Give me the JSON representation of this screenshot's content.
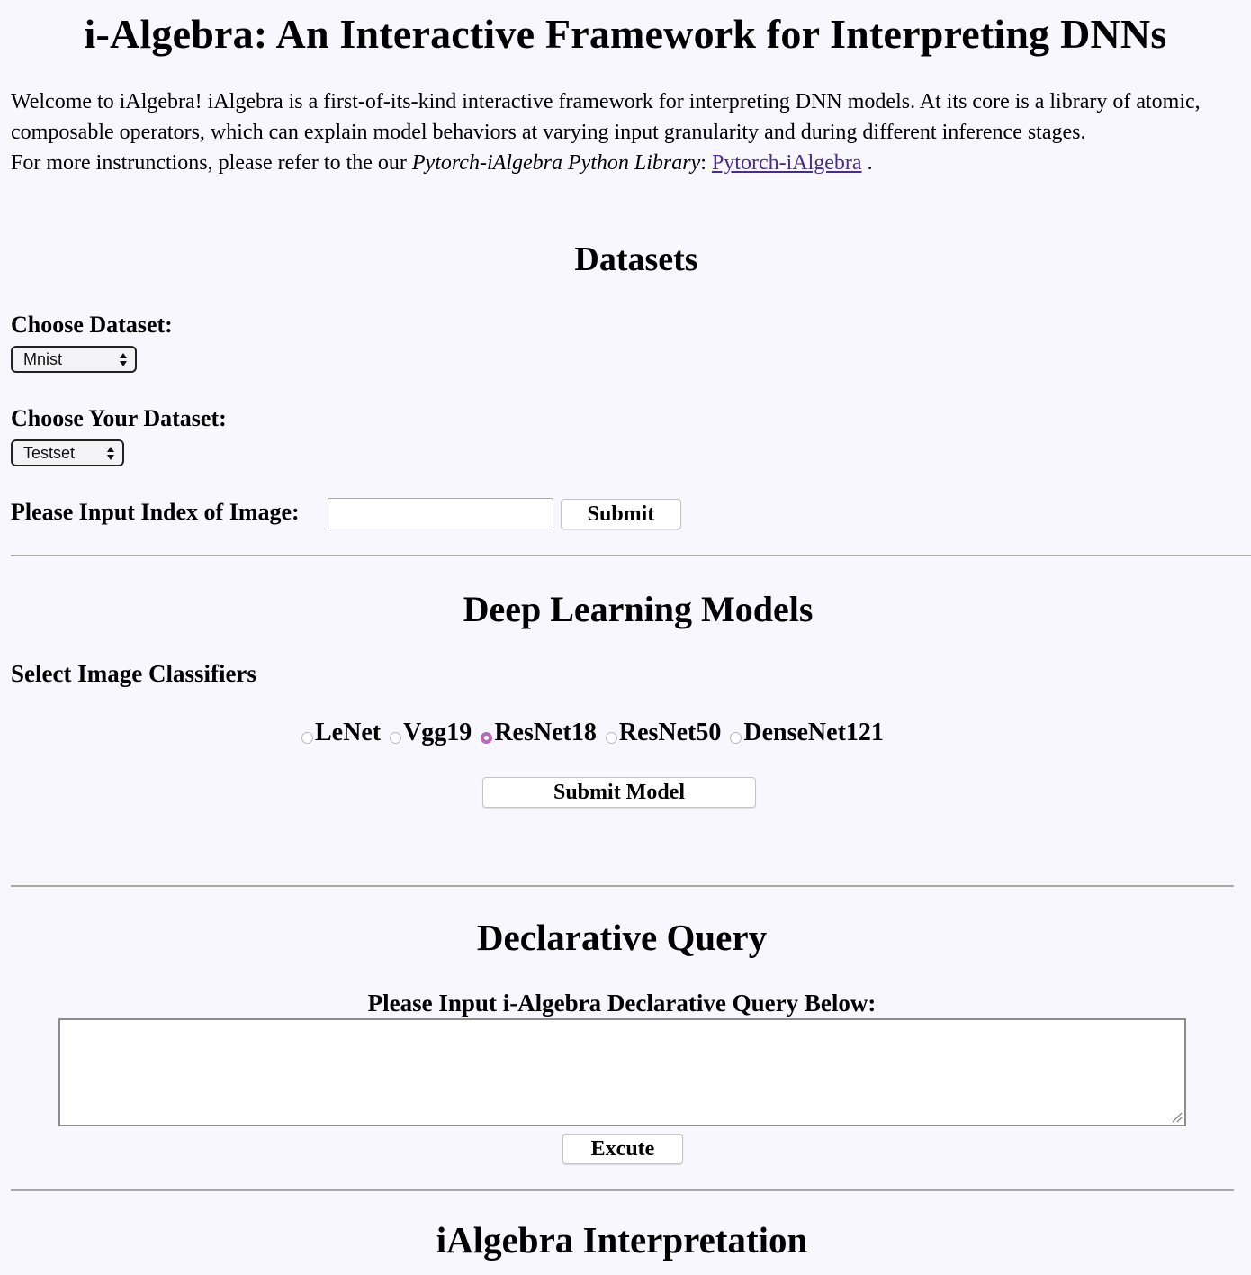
{
  "page": {
    "title": "i-Algebra: An Interactive Framework for Interpreting DNNs"
  },
  "intro": {
    "paragraph": "Welcome to iAlgebra! iAlgebra is a first-of-its-kind interactive framework for interpreting DNN models. At its core is a library of atomic, composable operators, which can explain model behaviors at varying input granularity and during different inference stages.",
    "more_prefix": "For more instrunctions, please refer to the our ",
    "more_italic": "Pytorch-iAlgebra Python Library",
    "more_colon": ": ",
    "link_text": "Pytorch-iAlgebra",
    "more_suffix": " ."
  },
  "datasets": {
    "heading": "Datasets",
    "choose_dataset_label": "Choose Dataset:",
    "dataset_selected": "Mnist",
    "choose_your_dataset_label": "Choose Your Dataset:",
    "split_selected": "Testset",
    "index_label": "Please Input Index of Image:",
    "index_value": "",
    "submit_label": "Submit"
  },
  "models": {
    "heading": "Deep Learning Models",
    "subheading": "Select Image Classifiers",
    "options": [
      {
        "label": "LeNet",
        "checked": false
      },
      {
        "label": "Vgg19",
        "checked": false
      },
      {
        "label": "ResNet18",
        "checked": true
      },
      {
        "label": "ResNet50",
        "checked": false
      },
      {
        "label": "DenseNet121",
        "checked": false
      }
    ],
    "submit_label": "Submit Model"
  },
  "query": {
    "heading": "Declarative Query",
    "label": "Please Input i-Algebra Declarative Query Below:",
    "value": "",
    "execute_label": "Excute"
  },
  "interpretation": {
    "heading": "iAlgebra Interpretation"
  },
  "colors": {
    "background": "#f8f7fd",
    "link": "#4b2a8f",
    "radio_checked": "#b86bb5",
    "rule": "#a8a8a8"
  }
}
